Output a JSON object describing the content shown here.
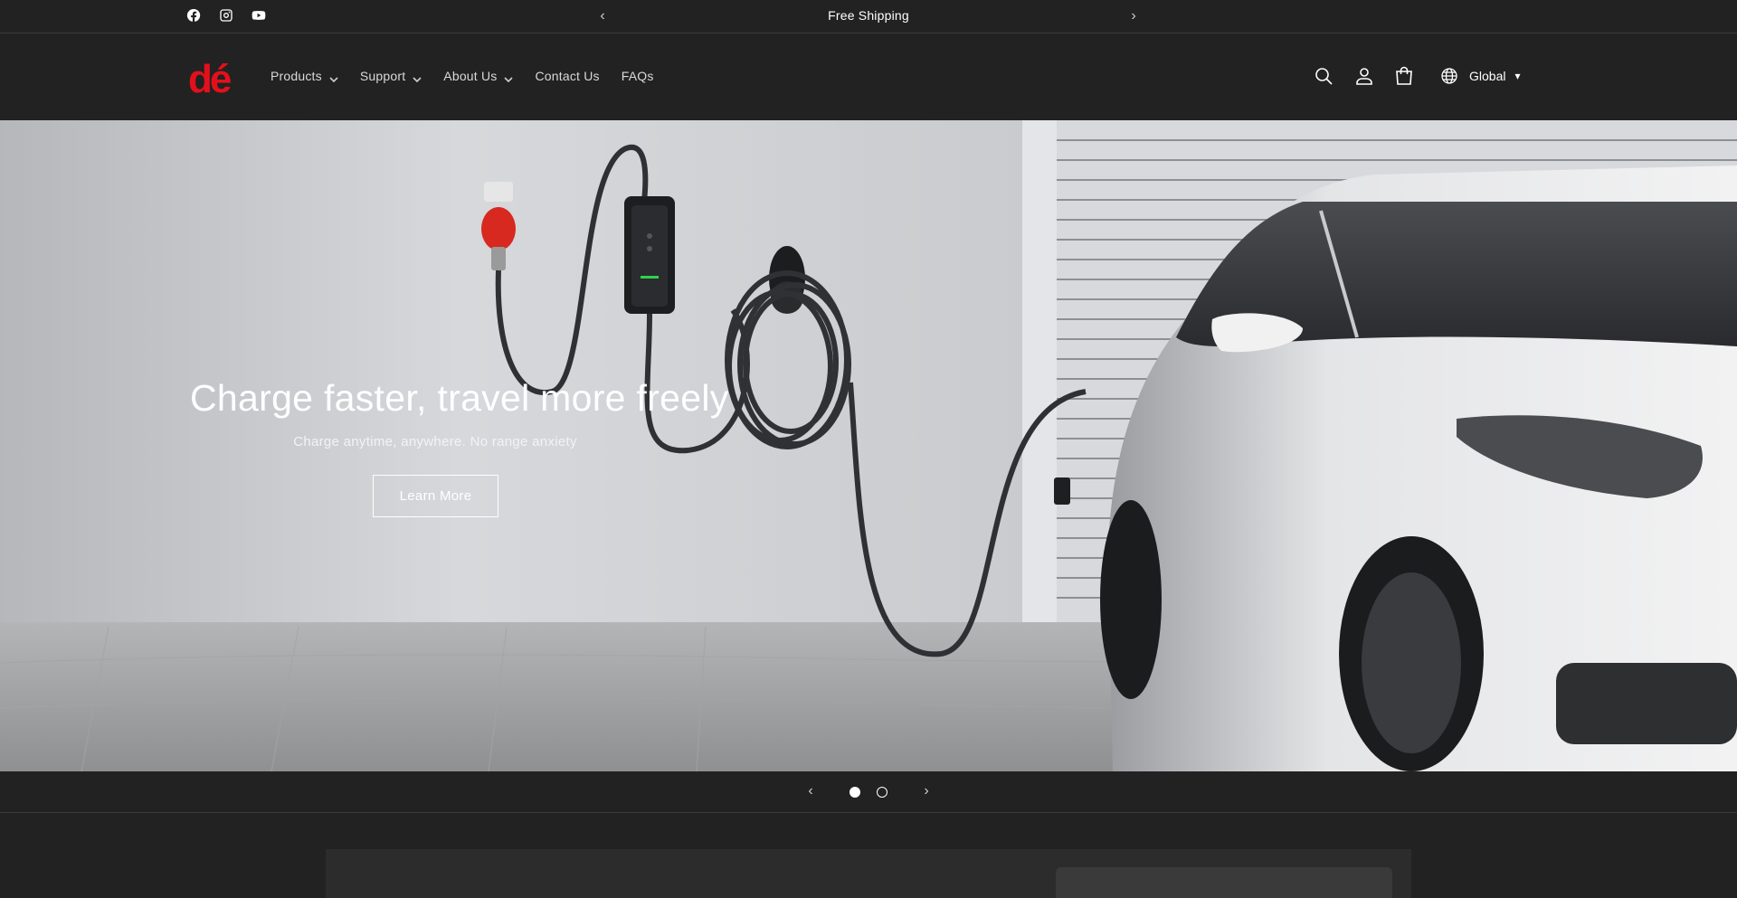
{
  "announcement": {
    "text": "Free Shipping",
    "prev_label": "‹",
    "next_label": "›"
  },
  "social": [
    {
      "name": "facebook-icon"
    },
    {
      "name": "instagram-icon"
    },
    {
      "name": "youtube-icon"
    }
  ],
  "header": {
    "logo_text": "dé",
    "nav": {
      "products": "Products",
      "support": "Support",
      "about": "About Us",
      "contact": "Contact Us",
      "faqs": "FAQs"
    },
    "locale": {
      "label": "Global",
      "caret": "▾"
    }
  },
  "hero": {
    "title": "Charge faster, travel more freely",
    "subtitle": "Charge anytime, anywhere. No range anxiety",
    "button_label": "Learn More"
  },
  "slider": {
    "prev_label": "‹",
    "next_label": "›",
    "active_slide": 1,
    "total_slides": 2
  },
  "colors": {
    "background": "#222222",
    "brand_red": "#e3101b",
    "text": "#ffffff"
  }
}
